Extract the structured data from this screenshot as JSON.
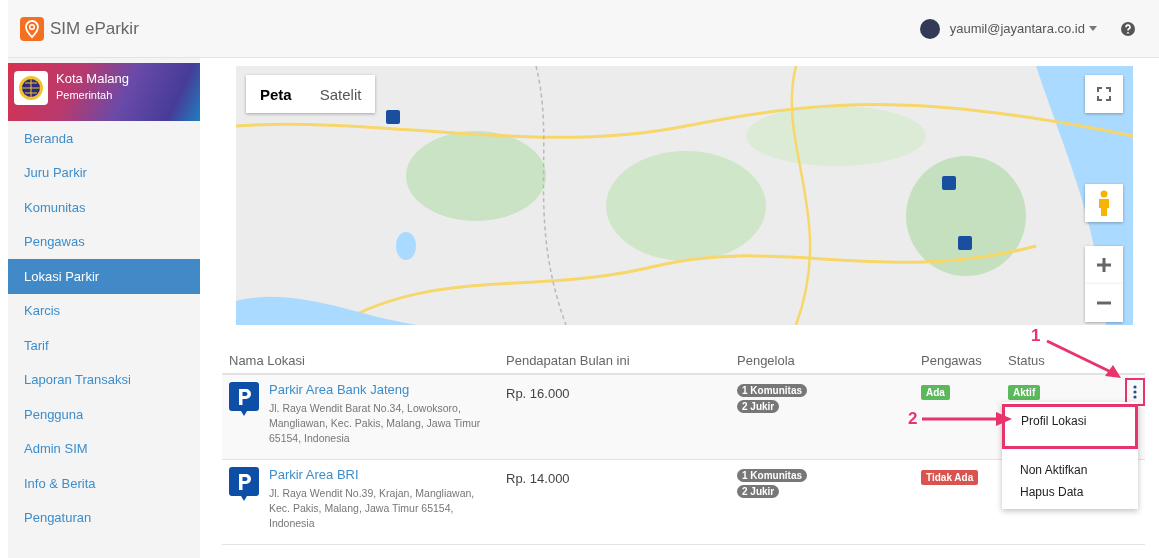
{
  "app": {
    "title": "SIM eParkir"
  },
  "user": {
    "email": "yaumil@jayantara.co.id"
  },
  "org": {
    "name": "Kota Malang",
    "type": "Pemerintah"
  },
  "sidebar": {
    "items": [
      {
        "label": "Beranda",
        "selected": false
      },
      {
        "label": "Juru Parkir",
        "selected": false
      },
      {
        "label": "Komunitas",
        "selected": false
      },
      {
        "label": "Pengawas",
        "selected": false
      },
      {
        "label": "Lokasi Parkir",
        "selected": true
      },
      {
        "label": "Karcis",
        "selected": false
      },
      {
        "label": "Tarif",
        "selected": false
      },
      {
        "label": "Laporan Transaksi",
        "selected": false
      },
      {
        "label": "Pengguna",
        "selected": false
      },
      {
        "label": "Admin SIM",
        "selected": false
      },
      {
        "label": "Info & Berita",
        "selected": false
      },
      {
        "label": "Pengaturan",
        "selected": false
      }
    ]
  },
  "map": {
    "kind": "picture",
    "map_types": [
      {
        "label": "Peta",
        "selected": true
      },
      {
        "label": "Satelit",
        "selected": false
      }
    ]
  },
  "table": {
    "columns": [
      "Nama Lokasi",
      "Pendapatan Bulan ini",
      "Pengelola",
      "Pengawas",
      "Status"
    ],
    "rows": [
      {
        "name": "Parkir Area Bank Jateng",
        "address": "Jl. Raya Wendit Barat No.34, Lowoksoro, Mangliawan, Kec. Pakis, Malang, Jawa Timur 65154, Indonesia",
        "income": "Rp. 16.000",
        "managers": [
          "1 Komunitas",
          "2 Jukir"
        ],
        "supervisor": {
          "label": "Ada",
          "color": "#5cb85c"
        },
        "status": {
          "label": "Aktif",
          "color": "#5cb85c"
        },
        "menu_open": true
      },
      {
        "name": "Parkir Area BRI",
        "address": "Jl. Raya Wendit No.39, Krajan, Mangliawan, Kec. Pakis, Malang, Jawa Timur 65154, Indonesia",
        "income": "Rp. 14.000",
        "managers": [
          "1 Komunitas",
          "2 Jukir"
        ],
        "supervisor": {
          "label": "Tidak Ada",
          "color": "#d9534f"
        }
      }
    ]
  },
  "row_menu": {
    "items": [
      {
        "label": "Profil Lokasi",
        "highlighted": true
      },
      {
        "label": "Non Aktifkan",
        "highlighted": false
      },
      {
        "label": "Hapus Data",
        "highlighted": false
      }
    ]
  },
  "annotations": [
    {
      "label": "1"
    },
    {
      "label": "2"
    }
  ]
}
